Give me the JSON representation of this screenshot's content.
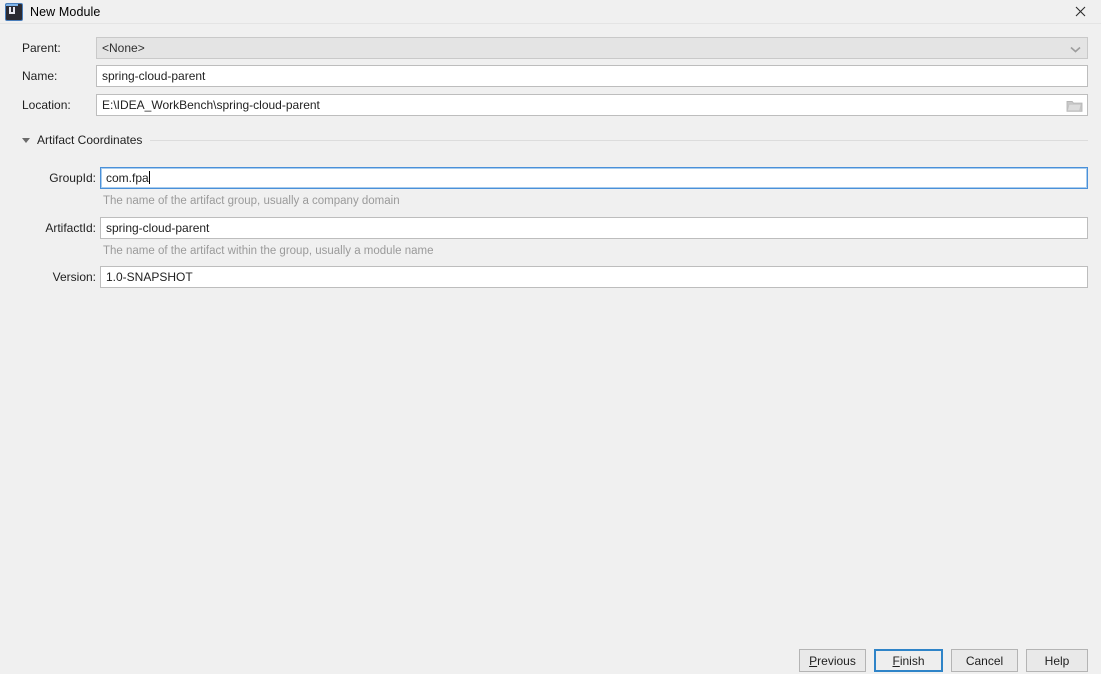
{
  "window": {
    "title": "New Module",
    "icon": "intellij-idea-icon",
    "close_label": "✕"
  },
  "form": {
    "rows": [
      {
        "label": "Parent:",
        "name": "parent",
        "value": "<None>",
        "type": "combobox",
        "icon": "chevron-down-icon"
      },
      {
        "label": "Name:",
        "name": "name",
        "value": "spring-cloud-parent",
        "type": "text"
      },
      {
        "label": "Location:",
        "name": "location",
        "value": "E:\\IDEA_WorkBench\\spring-cloud-parent",
        "type": "text",
        "icon": "folder-browse-icon"
      }
    ]
  },
  "artifact_section": {
    "title": "Artifact Coordinates",
    "expanded": true,
    "rows": [
      {
        "label": "GroupId:",
        "name": "groupid",
        "value": "com.fpa",
        "focused": true,
        "hint": "The name of the artifact group, usually a company domain"
      },
      {
        "label": "ArtifactId:",
        "name": "artifactid",
        "value": "spring-cloud-parent",
        "focused": false,
        "hint": "The name of the artifact within the group, usually a module name"
      },
      {
        "label": "Version:",
        "name": "version",
        "value": "1.0-SNAPSHOT",
        "focused": false,
        "hint": ""
      }
    ]
  },
  "footer": {
    "buttons": [
      {
        "name": "previous",
        "label": "Previous",
        "mnemonic": "P",
        "default": false
      },
      {
        "name": "finish",
        "label": "Finish",
        "mnemonic": "F",
        "default": true
      },
      {
        "name": "cancel",
        "label": "Cancel",
        "mnemonic": "",
        "default": false
      },
      {
        "name": "help",
        "label": "Help",
        "mnemonic": "",
        "default": false
      }
    ]
  },
  "colors": {
    "background": "#f0f0f0",
    "field_background": "#ffffff",
    "combo_background": "#e4e4e4",
    "focus_border": "#4a90d9",
    "default_button_border": "#2f84c8",
    "hint_text": "#9a9a9a"
  }
}
